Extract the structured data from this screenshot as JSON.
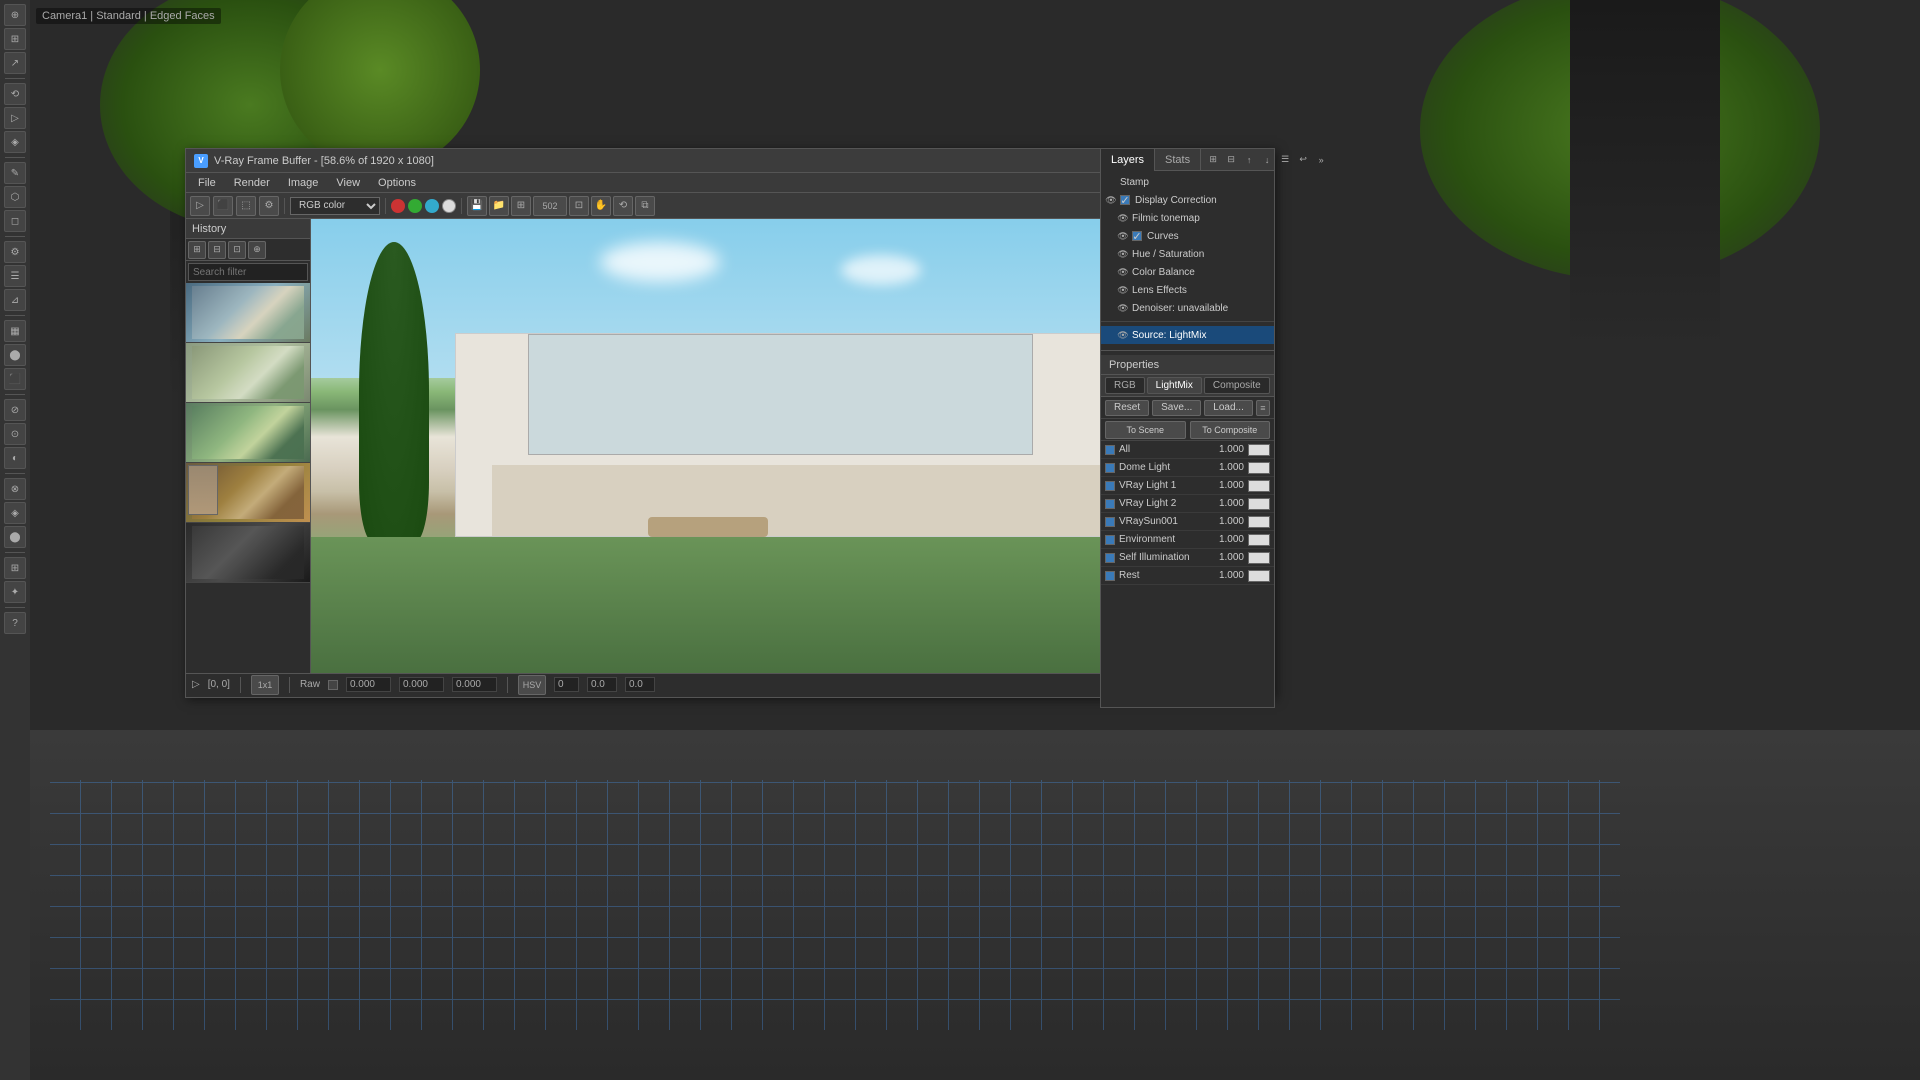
{
  "app": {
    "title": "V-Ray Frame Buffer - [58.6% of 1920 x 1080]",
    "icon": "V"
  },
  "viewport_label": "Camera1 | Standard | Edged Faces",
  "window": {
    "min": "─",
    "max": "□",
    "close": "✕"
  },
  "menubar": {
    "items": [
      "File",
      "Render",
      "Image",
      "View",
      "Options"
    ]
  },
  "toolbar": {
    "color_channel": "RGB color",
    "zoom_level": "502",
    "dots": [
      "red",
      "green",
      "cyan",
      "white_circle"
    ]
  },
  "history": {
    "title": "History",
    "search_placeholder": "Search filter",
    "buttons": [
      "⊞",
      "⊟",
      "⊡",
      "⊕"
    ]
  },
  "thumbnails": [
    {
      "id": 1,
      "class": "thumb-1"
    },
    {
      "id": 2,
      "class": "thumb-2"
    },
    {
      "id": 3,
      "class": "thumb-3"
    },
    {
      "id": 4,
      "class": "thumb-4"
    },
    {
      "id": 5,
      "class": "thumb-5"
    }
  ],
  "panels": {
    "tabs": [
      "Layers",
      "Stats"
    ],
    "active_tab": "Layers"
  },
  "layers": {
    "items": [
      {
        "id": "stamp",
        "label": "Stamp",
        "indent": 0,
        "has_eye": false,
        "has_check": false,
        "checked": false
      },
      {
        "id": "display-correction",
        "label": "Display Correction",
        "indent": 0,
        "has_eye": true,
        "has_check": true,
        "checked": true
      },
      {
        "id": "filmic-tonemap",
        "label": "Filmic tonemap",
        "indent": 1,
        "has_eye": true,
        "has_check": false,
        "checked": false
      },
      {
        "id": "curves",
        "label": "Curves",
        "indent": 1,
        "has_eye": true,
        "has_check": true,
        "checked": true
      },
      {
        "id": "hue-saturation",
        "label": "Hue / Saturation",
        "indent": 1,
        "has_eye": true,
        "has_check": false,
        "checked": false
      },
      {
        "id": "color-balance",
        "label": "Color Balance",
        "indent": 1,
        "has_eye": true,
        "has_check": false,
        "checked": false
      },
      {
        "id": "lens-effects",
        "label": "Lens Effects",
        "indent": 1,
        "has_eye": true,
        "has_check": false,
        "checked": false
      },
      {
        "id": "denoiser",
        "label": "Denoiser: unavailable",
        "indent": 1,
        "has_eye": true,
        "has_check": false,
        "checked": false
      },
      {
        "id": "source-lightmix",
        "label": "Source: LightMix",
        "indent": 1,
        "has_eye": true,
        "has_check": false,
        "checked": false,
        "selected": true
      }
    ]
  },
  "properties": {
    "title": "Properties",
    "tabs": [
      "RGB",
      "LightMix",
      "Composite"
    ],
    "active_tab": "LightMix",
    "buttons": {
      "reset": "Reset",
      "save": "Save...",
      "load": "Load...",
      "list": "≡"
    },
    "scene_buttons": [
      "To Scene",
      "To Composite"
    ],
    "lights": [
      {
        "name": "All",
        "value": "1.000",
        "checked": true
      },
      {
        "name": "Dome Light",
        "value": "1.000",
        "checked": true
      },
      {
        "name": "VRay Light 1",
        "value": "1.000",
        "checked": true
      },
      {
        "name": "VRay Light 2",
        "value": "1.000",
        "checked": true
      },
      {
        "name": "VRaySun001",
        "value": "1.000",
        "checked": true
      },
      {
        "name": "Environment",
        "value": "1.000",
        "checked": true
      },
      {
        "name": "Self Illumination",
        "value": "1.000",
        "checked": true
      },
      {
        "name": "Rest",
        "value": "1.000",
        "checked": true
      }
    ]
  },
  "statusbar": {
    "coords": "[0, 0]",
    "sample": "1x1",
    "mode": "Raw",
    "r": "0.000",
    "g": "0.000",
    "b": "0.000",
    "color_space": "HSV"
  }
}
